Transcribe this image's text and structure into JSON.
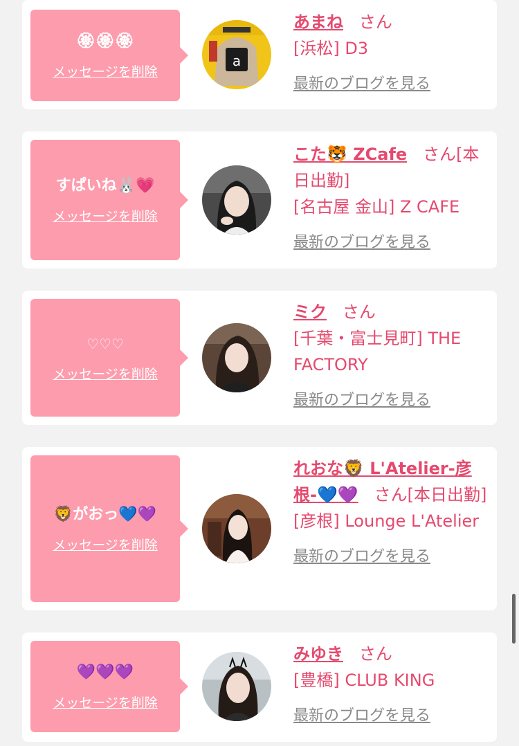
{
  "delete_label": "メッセージを削除",
  "blog_label": "最新のブログを見る",
  "san_label": "さん",
  "colors": {
    "background": "#f2f2f2",
    "bubble": "#fd9cad",
    "accent_pink": "#e5496e",
    "blog_link_gray": "#8a8a8a"
  },
  "entries": [
    {
      "message": "🏵🏵🏵",
      "name": "あまね",
      "status": "",
      "shop": "[浜松] D3",
      "avatar_icon": "magazine-photo-avatar"
    },
    {
      "message": "すぱいね🐰💗",
      "name": "こた🐯 ZCafe",
      "status": "[本日出勤]",
      "shop": "[名古屋 金山] Z CAFE",
      "avatar_icon": "girl-portrait-avatar"
    },
    {
      "message": "♡♡♡",
      "name": "ミク",
      "status": "",
      "shop": "[千葉・富士見町] THE FACTORY",
      "avatar_icon": "girl-portrait-avatar"
    },
    {
      "message": "🦁がおっ💙💜",
      "name": "れおな🦁 L'Atelier-彦根-💙💜",
      "status": "[本日出勤]",
      "shop": "[彦根] Lounge L'Atelier",
      "avatar_icon": "girl-portrait-avatar"
    },
    {
      "message": "💜💜💜",
      "name": "みゆき",
      "status": "",
      "shop": "[豊橋] CLUB KING",
      "avatar_icon": "girl-portrait-avatar"
    }
  ]
}
